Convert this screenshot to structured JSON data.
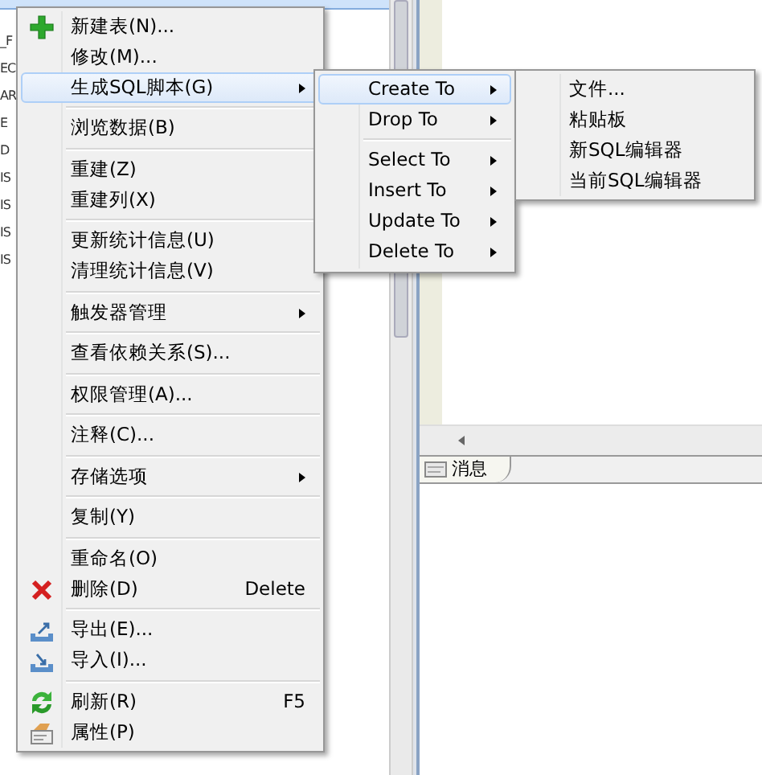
{
  "tree": {
    "rows": [
      {
        "selected": true
      },
      {
        "text": "_F",
        "selected": false
      },
      {
        "text": "EC",
        "selected": false
      },
      {
        "text": "AR",
        "selected": false
      },
      {
        "text": "E",
        "selected": false
      },
      {
        "text": "D",
        "selected": false
      },
      {
        "text": "IS",
        "selected": false
      },
      {
        "text": "IS",
        "selected": false
      },
      {
        "text": "IS",
        "selected": false
      },
      {
        "text": "IS",
        "selected": false
      }
    ]
  },
  "context_menu": {
    "groups": [
      [
        {
          "label": "新建表(N)...",
          "submenu": false,
          "selected": false
        },
        {
          "label": "修改(M)...",
          "submenu": false,
          "selected": false
        },
        {
          "label": "生成SQL脚本(G)",
          "submenu": true,
          "selected": true
        }
      ],
      [
        {
          "label": "浏览数据(B)",
          "submenu": false,
          "selected": false
        }
      ],
      [
        {
          "label": "重建(Z)",
          "submenu": false,
          "selected": false
        },
        {
          "label": "重建列(X)",
          "submenu": false,
          "selected": false
        }
      ],
      [
        {
          "label": "更新统计信息(U)",
          "submenu": false,
          "selected": false
        },
        {
          "label": "清理统计信息(V)",
          "submenu": false,
          "selected": false
        }
      ],
      [
        {
          "label": "触发器管理",
          "submenu": true,
          "selected": false
        }
      ],
      [
        {
          "label": "查看依赖关系(S)...",
          "submenu": false,
          "selected": false
        }
      ],
      [
        {
          "label": "权限管理(A)...",
          "submenu": false,
          "selected": false
        }
      ],
      [
        {
          "label": "注释(C)...",
          "submenu": false,
          "selected": false
        }
      ],
      [
        {
          "label": "存储选项",
          "submenu": true,
          "selected": false
        }
      ],
      [
        {
          "label": "复制(Y)",
          "submenu": false,
          "selected": false
        }
      ],
      [
        {
          "label": "重命名(O)",
          "submenu": false,
          "selected": false
        },
        {
          "label": "删除(D)",
          "shortcut": "Delete",
          "submenu": false,
          "selected": false
        }
      ],
      [
        {
          "label": "导出(E)...",
          "submenu": false,
          "selected": false
        },
        {
          "label": "导入(I)...",
          "submenu": false,
          "selected": false
        }
      ],
      [
        {
          "label": "刷新(R)",
          "shortcut": "F5",
          "submenu": false,
          "selected": false
        },
        {
          "label": "属性(P)",
          "submenu": false,
          "selected": false
        }
      ]
    ]
  },
  "sql_submenu": {
    "groups": [
      [
        {
          "label": "Create To",
          "submenu": true,
          "selected": true
        },
        {
          "label": "Drop To",
          "submenu": true,
          "selected": false
        }
      ],
      [
        {
          "label": "Select To",
          "submenu": true,
          "selected": false
        },
        {
          "label": "Insert To",
          "submenu": true,
          "selected": false
        },
        {
          "label": "Update To",
          "submenu": true,
          "selected": false
        },
        {
          "label": "Delete To",
          "submenu": true,
          "selected": false
        }
      ]
    ]
  },
  "create_submenu": {
    "groups": [
      [
        {
          "label": "文件...",
          "submenu": false,
          "selected": false
        },
        {
          "label": "粘贴板",
          "submenu": false,
          "selected": false
        },
        {
          "label": "新SQL编辑器",
          "submenu": false,
          "selected": false
        },
        {
          "label": "当前SQL编辑器",
          "submenu": false,
          "selected": false
        }
      ]
    ]
  },
  "bottom_tabs": [
    {
      "label": "消息",
      "selected": true
    }
  ]
}
